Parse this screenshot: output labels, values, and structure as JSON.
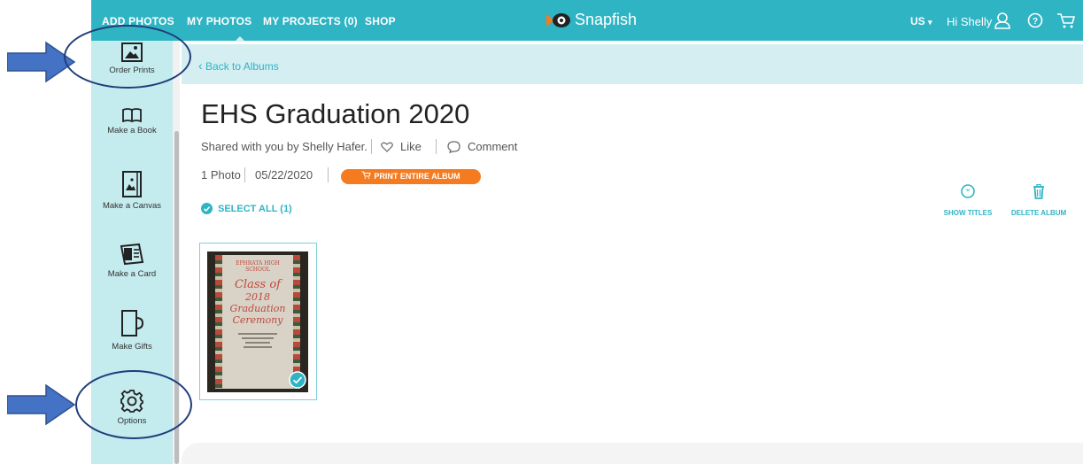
{
  "topbar": {
    "nav": [
      "ADD PHOTOS",
      "MY PHOTOS",
      "MY PROJECTS (0)",
      "SHOP"
    ],
    "brand": "Snapfish",
    "region": "US",
    "region_caret": "▾",
    "greeting": "Hi Shelly",
    "icons": [
      "user-icon",
      "help-icon",
      "cart-icon"
    ]
  },
  "sidebar": {
    "items": [
      {
        "label": "Order Prints",
        "icon": "picture-icon"
      },
      {
        "label": "Make a Book",
        "icon": "book-icon"
      },
      {
        "label": "Make a Canvas",
        "icon": "canvas-icon"
      },
      {
        "label": "Make a Card",
        "icon": "card-icon"
      },
      {
        "label": "Make Gifts",
        "icon": "mug-icon"
      },
      {
        "label": "Options",
        "icon": "gear-icon"
      }
    ]
  },
  "back": {
    "label": "Back to Albums",
    "chevron": "‹"
  },
  "album": {
    "title": "EHS Graduation 2020",
    "shared_by": "Shared with you by Shelly Hafer.",
    "like_label": "Like",
    "comment_label": "Comment",
    "photo_count": "1 Photo",
    "date": "05/22/2020",
    "print_button": "PRINT ENTIRE ALBUM",
    "select_all": "SELECT ALL (1)"
  },
  "actions": {
    "show_titles": "SHOW TITLES",
    "delete_album": "DELETE ALBUM"
  },
  "photo": {
    "lines": [
      "EPHRATA HIGH",
      "SCHOOL",
      "Class of",
      "2018",
      "Graduation",
      "Ceremony"
    ],
    "selected": true
  },
  "colors": {
    "brand_teal": "#2fb4c4",
    "sidebar_bg": "#c4ebee",
    "orange": "#f47b20",
    "annotation_blue": "#4472c4",
    "annotation_ring": "#1f3d7a"
  },
  "annotations": {
    "arrows": [
      "arrow-to-order-prints",
      "arrow-to-options"
    ]
  }
}
